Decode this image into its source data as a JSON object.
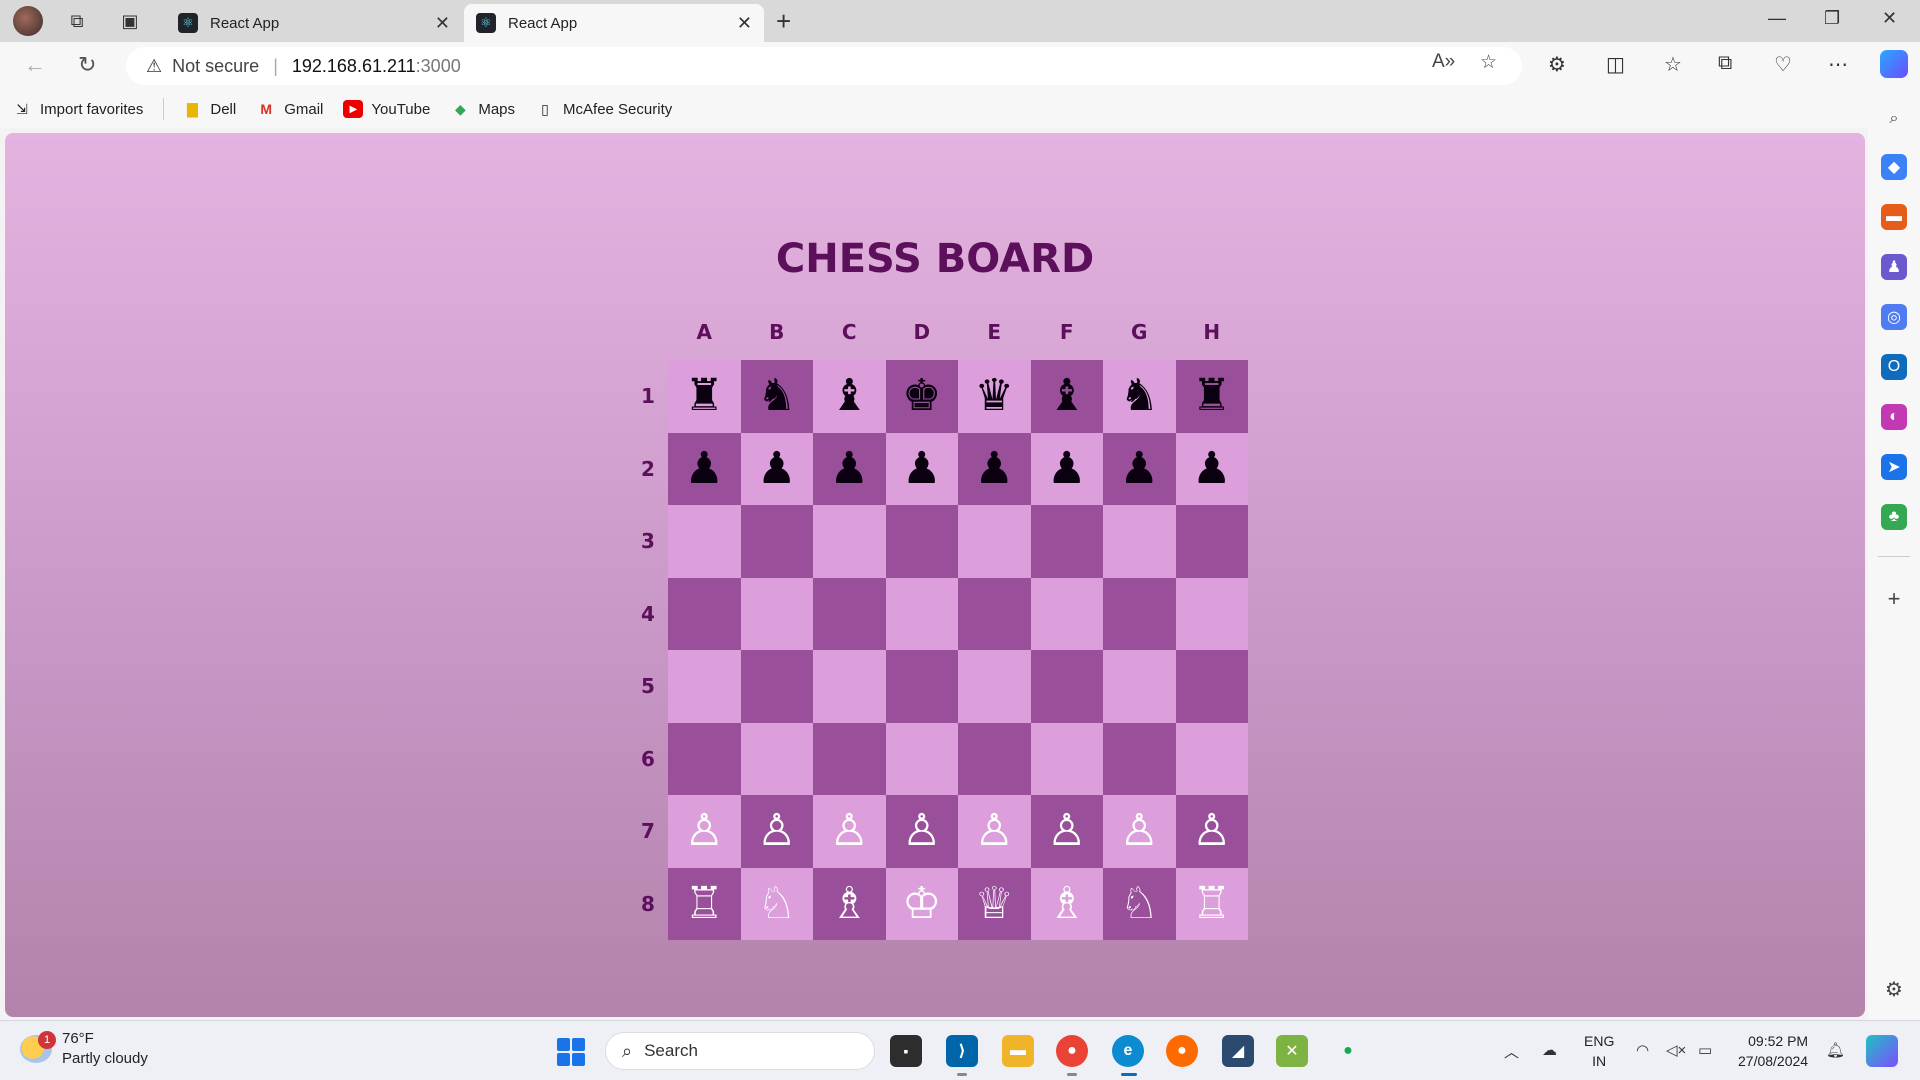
{
  "browser": {
    "tabs": [
      {
        "label": "React App",
        "active": false
      },
      {
        "label": "React App",
        "active": true
      }
    ],
    "address": {
      "security_label": "Not secure",
      "host": "192.168.61.211",
      "port": ":3000"
    },
    "bookmarks": [
      {
        "label": "Import favorites",
        "icon": "import-icon"
      },
      {
        "label": "Dell",
        "icon": "folder-icon"
      },
      {
        "label": "Gmail",
        "icon": "gmail-icon"
      },
      {
        "label": "YouTube",
        "icon": "youtube-icon"
      },
      {
        "label": "Maps",
        "icon": "maps-icon"
      },
      {
        "label": "McAfee Security",
        "icon": "page-icon"
      }
    ]
  },
  "page": {
    "title": "CHESS BOARD",
    "files": [
      "A",
      "B",
      "C",
      "D",
      "E",
      "F",
      "G",
      "H"
    ],
    "ranks": [
      "1",
      "2",
      "3",
      "4",
      "5",
      "6",
      "7",
      "8"
    ],
    "light_color": "#dc9fdb",
    "dark_color": "#9a4f9a",
    "board": [
      [
        "♜",
        "♞",
        "♝",
        "♚",
        "♛",
        "♝",
        "♞",
        "♜"
      ],
      [
        "♟",
        "♟",
        "♟",
        "♟",
        "♟",
        "♟",
        "♟",
        "♟"
      ],
      [
        "",
        "",
        "",
        "",
        "",
        "",
        "",
        ""
      ],
      [
        "",
        "",
        "",
        "",
        "",
        "",
        "",
        ""
      ],
      [
        "",
        "",
        "",
        "",
        "",
        "",
        "",
        ""
      ],
      [
        "",
        "",
        "",
        "",
        "",
        "",
        "",
        ""
      ],
      [
        "♙",
        "♙",
        "♙",
        "♙",
        "♙",
        "♙",
        "♙",
        "♙"
      ],
      [
        "♖",
        "♘",
        "♗",
        "♔",
        "♕",
        "♗",
        "♘",
        "♖"
      ]
    ]
  },
  "taskbar": {
    "weather": {
      "temp": "76°F",
      "desc": "Partly cloudy",
      "badge": "1"
    },
    "search_label": "Search",
    "lang": [
      "ENG",
      "IN"
    ],
    "time": "09:52 PM",
    "date": "27/08/2024"
  }
}
